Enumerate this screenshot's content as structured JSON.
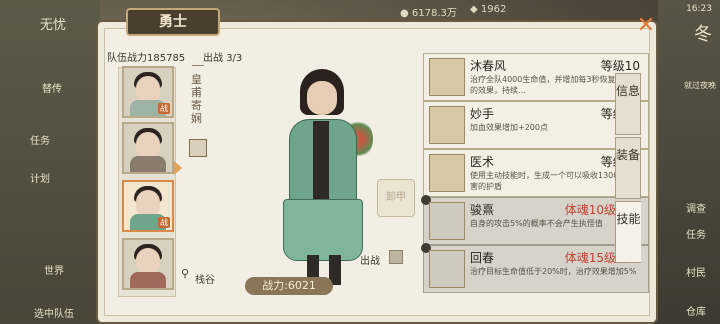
{
  "top": {
    "gold": "6178.3万",
    "gems": "1962",
    "time": "16:23"
  },
  "left_menu": [
    "无忧",
    "替传",
    "任务",
    "计划",
    "世界",
    "选中队伍"
  ],
  "right_menu": [
    "冬",
    "就过夜晚",
    "调查",
    "任务",
    "村民",
    "仓库"
  ],
  "title": "勇士",
  "team_power_label": "队伍战力",
  "team_power": "185785",
  "deploy_label": "出战",
  "deploy_count": "3/3",
  "hero_name_vertical": "皇甫寄娴",
  "heroes": [
    {
      "name": "hero-1",
      "badge": "战",
      "color": "#9fb3a4"
    },
    {
      "name": "hero-2",
      "badge": "",
      "color": "#8a7d6b"
    },
    {
      "name": "hero-3",
      "badge": "战",
      "color": "#6fa58a"
    },
    {
      "name": "hero-4",
      "badge": "",
      "color": "#a06a5a"
    }
  ],
  "location": "栈谷",
  "power_label": "战力:",
  "power_value": "6021",
  "unequip_label": "卸甲",
  "battle_label": "出战",
  "skills": [
    {
      "name": "沐春风",
      "level": "等级10",
      "desc": "治疗全队4000生命值，并增加每3秒恢复生命值的效果，持续…",
      "locked": false
    },
    {
      "name": "妙手",
      "level": "等级10",
      "desc": "加血效果增加+200点",
      "locked": false
    },
    {
      "name": "医术",
      "level": "等级10",
      "desc": "使用主动技能时，生成一个可以吸收1300点伤害的护盾",
      "locked": false
    },
    {
      "name": "骏熹",
      "level": "体魂10级解锁",
      "desc": "自身的攻击5%的概率不会产生执怪值",
      "locked": true
    },
    {
      "name": "回春",
      "level": "体魂15级解锁",
      "desc": "治疗目标生命值低于20%时，治疗效果增加5%",
      "locked": true
    }
  ],
  "side_tabs": [
    "信息",
    "装备",
    "技能"
  ],
  "colors": {
    "accent": "#e07a3a",
    "locked_red": "#c24230"
  }
}
